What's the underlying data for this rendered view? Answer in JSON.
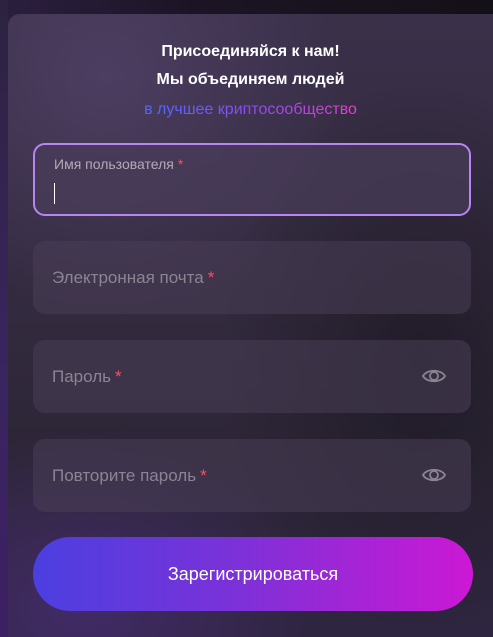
{
  "header": {
    "line1": "Присоединяйся к нам!",
    "line2": "Мы объединяем людей",
    "tagline": "в лучшее криптосообщество"
  },
  "form": {
    "username": {
      "label": "Имя пользователя",
      "required_mark": "*",
      "value": ""
    },
    "email": {
      "placeholder": "Электронная почта",
      "required_mark": "*"
    },
    "password": {
      "placeholder": "Пароль",
      "required_mark": "*"
    },
    "password_repeat": {
      "placeholder": "Повторите пароль",
      "required_mark": "*"
    },
    "submit_label": "Зарегистрироваться"
  },
  "icons": {
    "show_password": "eye-icon"
  },
  "colors": {
    "focus_border": "#b886f2",
    "required": "#ff4d5e",
    "gradient_start": "#4b3fe0",
    "gradient_end": "#cc18d4"
  }
}
